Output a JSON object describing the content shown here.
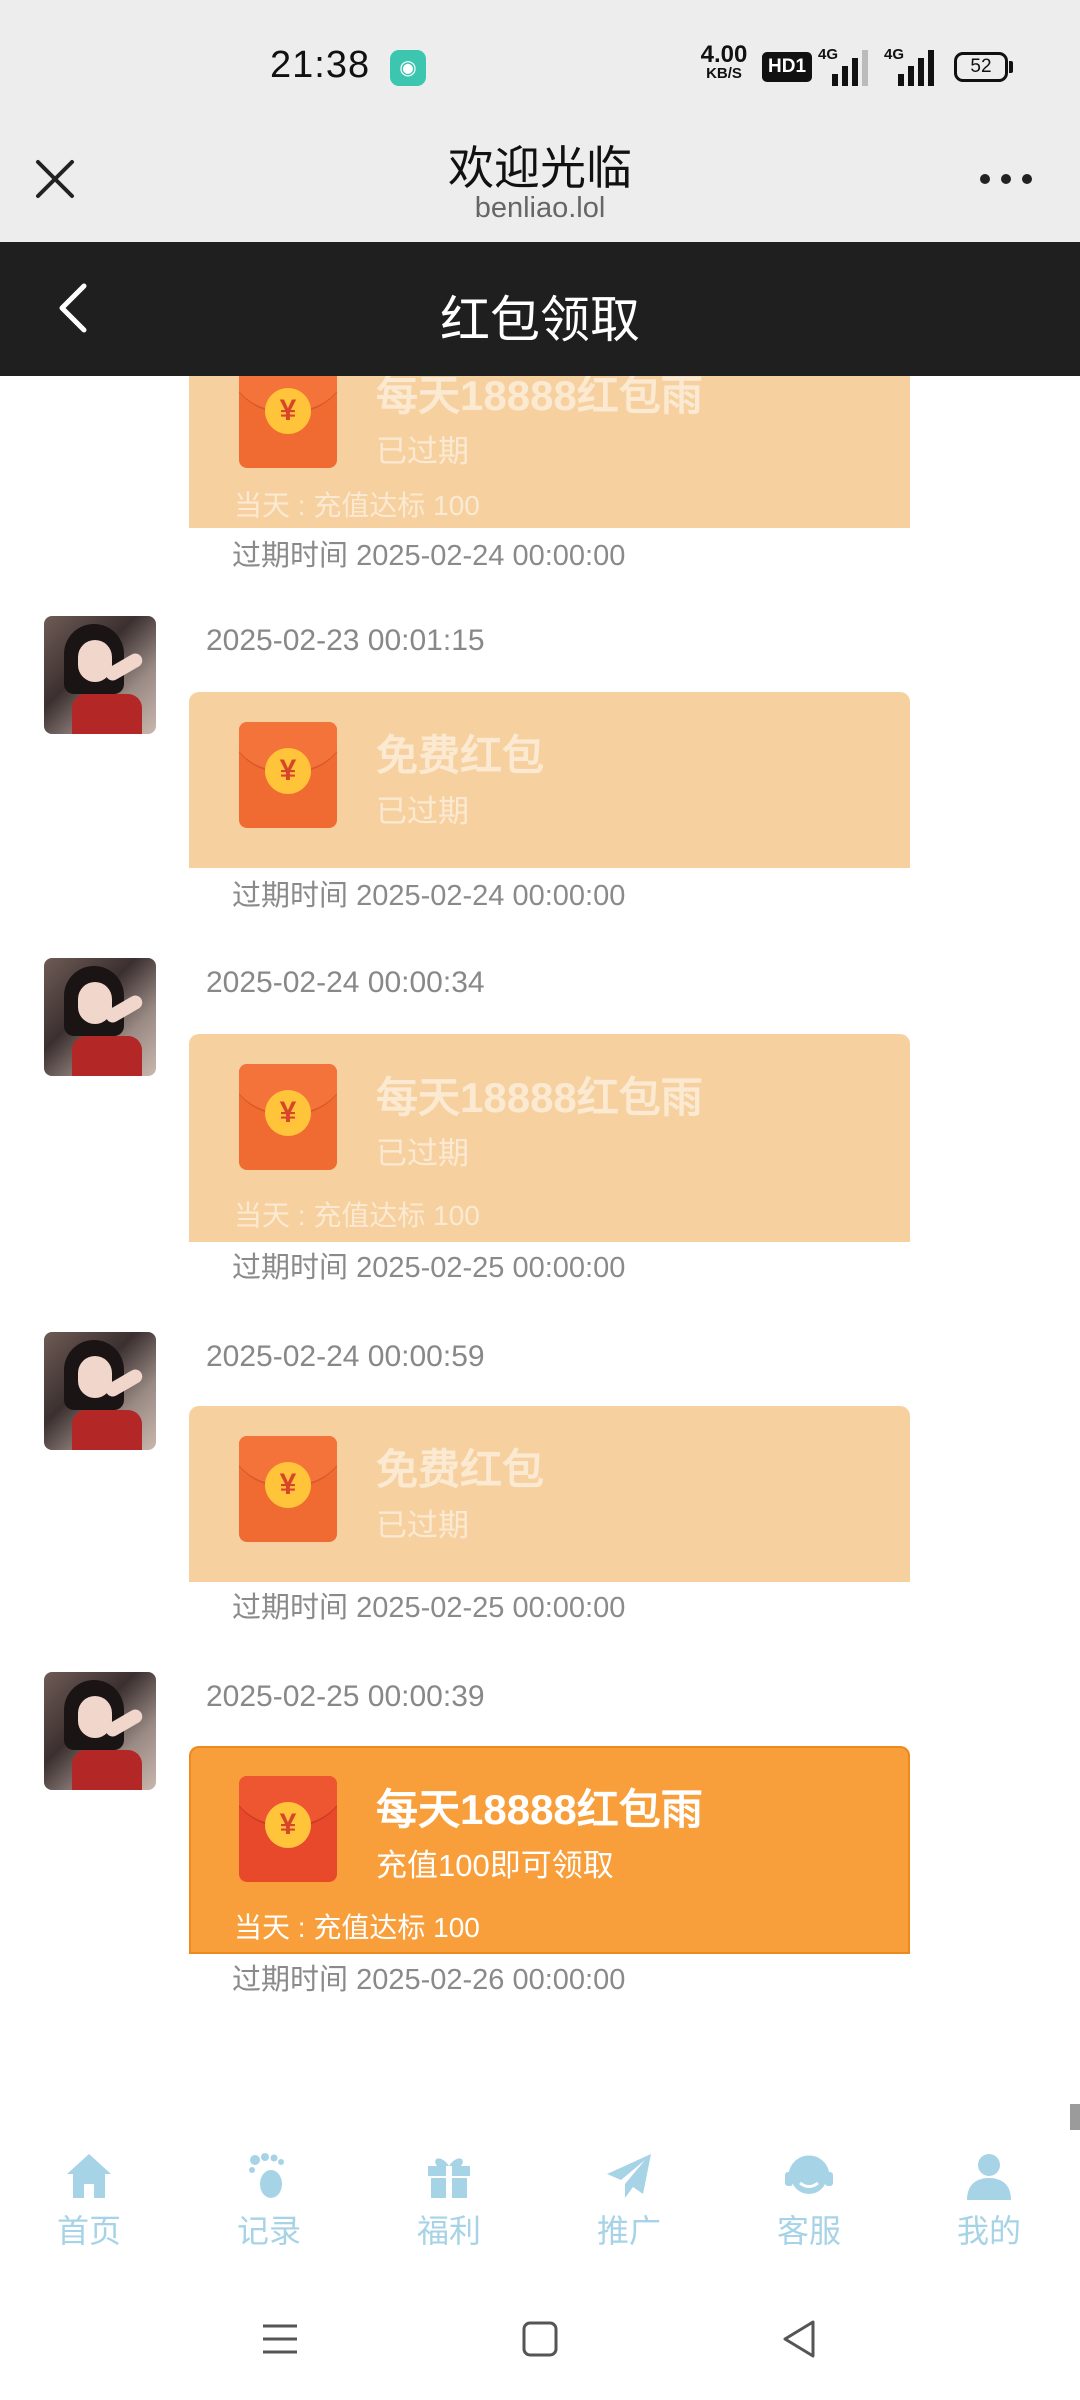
{
  "status_bar": {
    "time": "21:38",
    "net_speed_value": "4.00",
    "net_speed_unit": "KB/S",
    "hd_label": "HD1",
    "sim1_label": "4G",
    "sim2_label": "4G",
    "battery": "52"
  },
  "browser": {
    "title": "欢迎光临",
    "url": "benliao.lol"
  },
  "page": {
    "title": "红包领取"
  },
  "messages": [
    {
      "time": "",
      "packet_title": "每天18888红包雨",
      "packet_status": "已过期",
      "condition": "当天 : 充值达标 100",
      "expiry_label": "过期时间",
      "expiry_time": "2025-02-24 00:00:00",
      "state": "expired"
    },
    {
      "time": "2025-02-23 00:01:15",
      "packet_title": "免费红包",
      "packet_status": "已过期",
      "condition": "",
      "expiry_label": "过期时间",
      "expiry_time": "2025-02-24 00:00:00",
      "state": "expired"
    },
    {
      "time": "2025-02-24 00:00:34",
      "packet_title": "每天18888红包雨",
      "packet_status": "已过期",
      "condition": "当天 : 充值达标 100",
      "expiry_label": "过期时间",
      "expiry_time": "2025-02-25 00:00:00",
      "state": "expired"
    },
    {
      "time": "2025-02-24 00:00:59",
      "packet_title": "免费红包",
      "packet_status": "已过期",
      "condition": "",
      "expiry_label": "过期时间",
      "expiry_time": "2025-02-25 00:00:00",
      "state": "expired"
    },
    {
      "time": "2025-02-25 00:00:39",
      "packet_title": "每天18888红包雨",
      "packet_status": "充值100即可领取",
      "condition": "当天 : 充值达标 100",
      "expiry_label": "过期时间",
      "expiry_time": "2025-02-26 00:00:00",
      "state": "active"
    }
  ],
  "envelope_symbol": "¥",
  "tabs": [
    {
      "label": "首页",
      "icon": "home-icon"
    },
    {
      "label": "记录",
      "icon": "footprint-icon"
    },
    {
      "label": "福利",
      "icon": "gift-icon"
    },
    {
      "label": "推广",
      "icon": "paper-plane-icon"
    },
    {
      "label": "客服",
      "icon": "headset-icon"
    },
    {
      "label": "我的",
      "icon": "user-icon"
    }
  ],
  "colors": {
    "expired_packet": "#f6d19f",
    "active_packet": "#f89f3b",
    "tab_icon": "#a7d3e6",
    "header_bg": "#1f1f1f"
  }
}
